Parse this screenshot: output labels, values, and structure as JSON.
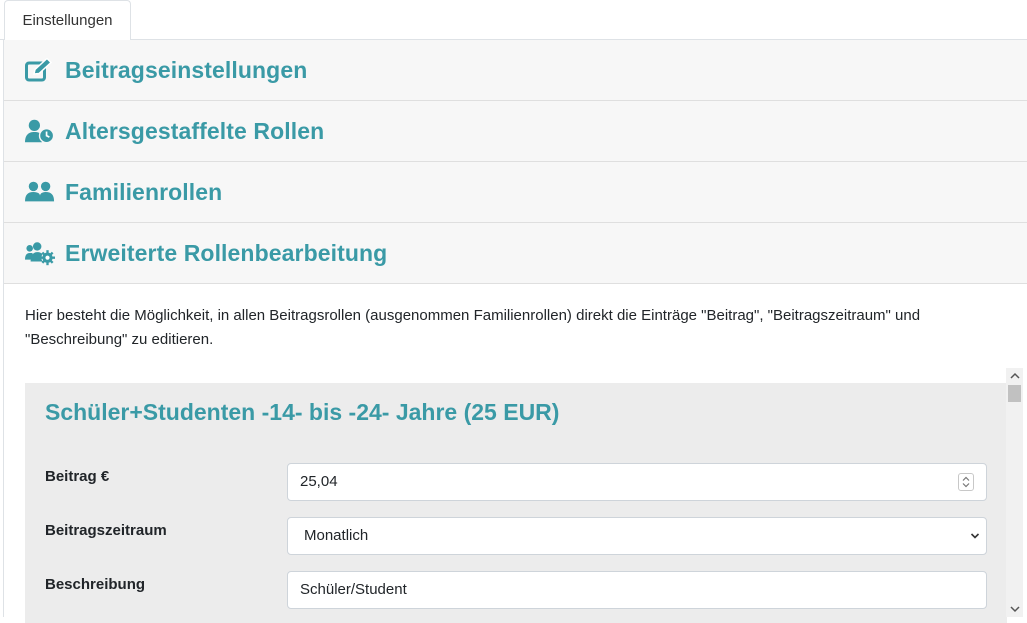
{
  "tabs": [
    {
      "label": "Einstellungen"
    }
  ],
  "accordion": [
    {
      "title": "Beitragseinstellungen",
      "icon": "edit-icon"
    },
    {
      "title": "Altersgestaffelte Rollen",
      "icon": "user-clock-icon"
    },
    {
      "title": "Familienrollen",
      "icon": "users-icon"
    },
    {
      "title": "Erweiterte Rollenbearbeitung",
      "icon": "users-cog-icon"
    }
  ],
  "description": "Hier besteht die Möglichkeit, in allen Beitragsrollen (ausgenommen Familienrollen) direkt die Einträge \"Beitrag\", \"Beitragszeitraum\" und \"Beschreibung\" zu editieren.",
  "card": {
    "title": "Schüler+Studenten -14- bis -24- Jahre (25 EUR)",
    "fields": {
      "beitrag_label": "Beitrag €",
      "beitrag_value": "25,04",
      "zeitraum_label": "Beitragszeitraum",
      "zeitraum_value": "Monatlich",
      "beschreibung_label": "Beschreibung",
      "beschreibung_value": "Schüler/Student"
    }
  },
  "colors": {
    "accent": "#3a9aa6",
    "header_bg": "#f7f7f7",
    "card_bg": "#ececec"
  }
}
